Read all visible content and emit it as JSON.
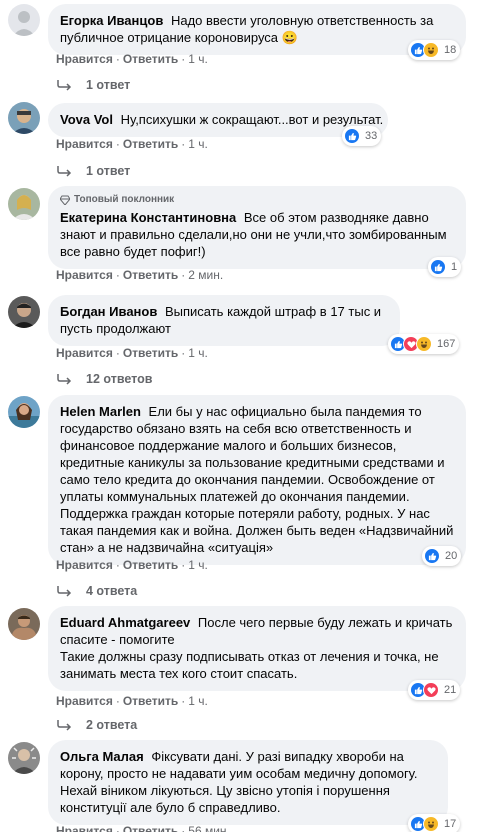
{
  "comments": [
    {
      "author": "Егорка Иванцов",
      "text": "Надо ввести уголовную ответственность за публичное отрицание короновируса 😀",
      "actions": {
        "like": "Нравится",
        "reply": "Ответить",
        "time": "1 ч."
      },
      "reactions": {
        "types": [
          "like-icon",
          "haha-icon"
        ],
        "count": "18"
      },
      "replies_label": "1 ответ"
    },
    {
      "author": "Vova Vol",
      "text": "Ну,психушки ж сокращают...вот и результат.",
      "actions": {
        "like": "Нравится",
        "reply": "Ответить",
        "time": "1 ч."
      },
      "reactions": {
        "types": [
          "like-icon"
        ],
        "count": "33"
      },
      "replies_label": "1 ответ"
    },
    {
      "badge": "Топовый поклонник",
      "author": "Екатерина Константиновна",
      "text": "Все об этом разводняке давно знают и правильно сделали,но они не учли,что зомбированным все равно будет пофиг!)",
      "actions": {
        "like": "Нравится",
        "reply": "Ответить",
        "time": "2 мин."
      },
      "reactions": {
        "types": [
          "like-icon"
        ],
        "count": "1"
      }
    },
    {
      "author": "Богдан Иванов",
      "text": "Выписать каждой штраф в 17 тыс и пусть продолжают",
      "actions": {
        "like": "Нравится",
        "reply": "Ответить",
        "time": "1 ч."
      },
      "reactions": {
        "types": [
          "like-icon",
          "love-icon",
          "haha-icon"
        ],
        "count": "167"
      },
      "replies_label": "12 ответов"
    },
    {
      "author": "Helen Marlen",
      "text": "Ели бы у нас официально была пандемия то государство обязано взять на себя всю ответственность и финансовое поддержание малого и больших бизнесов, кредитные каникулы за пользование кредитными средствами и само тело кредита до окончания пандемии. Освобождение от уплаты коммунальных платежей до окончания пандемии. Поддержка граждан которые потеряли работу, родных. У нас такая пандемия как и война. Должен быть веден «Надзвичайний стан» а не надзвичайна «ситуація»",
      "actions": {
        "like": "Нравится",
        "reply": "Ответить",
        "time": "1 ч."
      },
      "reactions": {
        "types": [
          "like-icon"
        ],
        "count": "20"
      },
      "replies_label": "4 ответа"
    },
    {
      "author": "Eduard Ahmatgareev",
      "text": "После чего первые буду лежать и кричать спасите - помогите",
      "text2": "Такие должны сразу подписывать отказ от лечения и точка, не занимать места тех кого стоит спасать.",
      "actions": {
        "like": "Нравится",
        "reply": "Ответить",
        "time": "1 ч."
      },
      "reactions": {
        "types": [
          "like-icon",
          "love-icon"
        ],
        "count": "21"
      },
      "replies_label": "2 ответа"
    },
    {
      "author": "Ольга Малая",
      "text": "Фіксувати дані. У разі випадку хвороби на корону, просто не надавати уим особам медичну допомогу. Нехай віником лікуються. Цу звісно утопія і порушення конституції але було б справедливо.",
      "actions": {
        "like": "Нравится",
        "reply": "Ответить",
        "time": "56 мин."
      },
      "reactions": {
        "types": [
          "like-icon",
          "haha-icon"
        ],
        "count": "17"
      }
    }
  ],
  "colors": {
    "like": "#1877f2",
    "haha": "#f7b928",
    "love": "#f33e58",
    "bubble": "#f0f2f5",
    "meta": "#65676b"
  }
}
